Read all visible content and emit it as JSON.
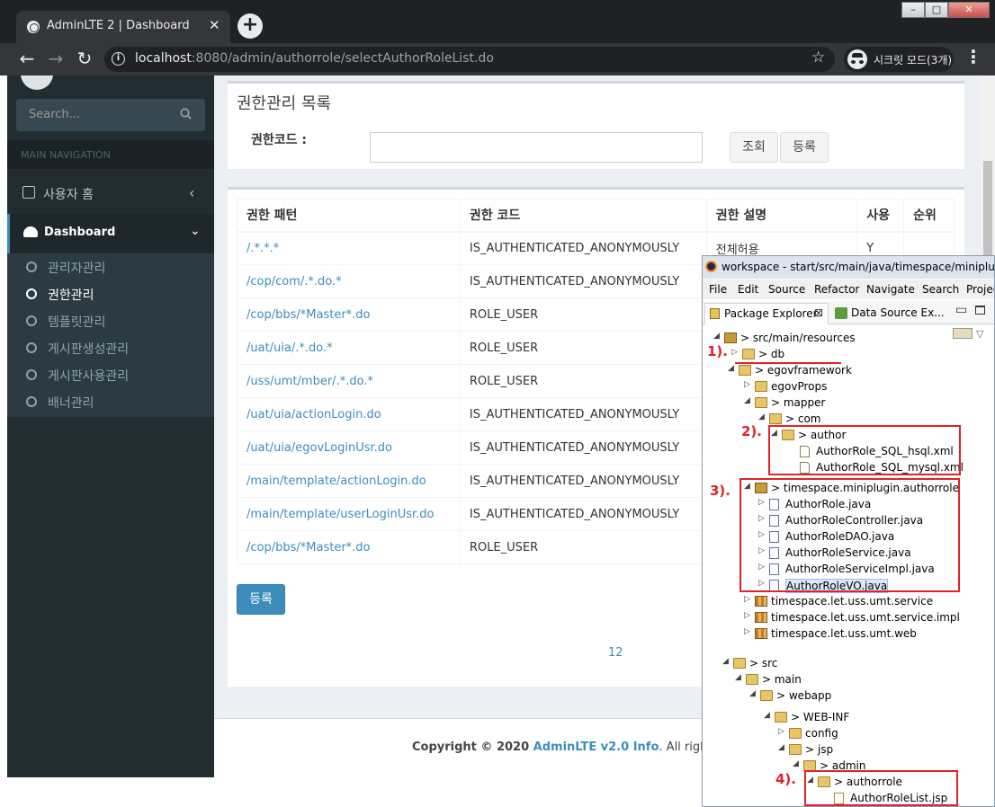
{
  "browser": {
    "tab_title": "AdminLTE 2 | Dashboard",
    "tab_close": "✕",
    "new_tab": "+",
    "url_host": "localhost",
    "url_rest": ":8080/admin/authorrole/selectAuthorRoleList.do",
    "incognito_label": "시크릿 모드(3개)",
    "window_min": "–",
    "window_max": "□",
    "window_close": "✕"
  },
  "sidebar": {
    "search_placeholder": "Search...",
    "header": "MAIN NAVIGATION",
    "home_label": "사용자 홈",
    "dashboard_label": "Dashboard",
    "submenu": [
      {
        "label": "관리자관리"
      },
      {
        "label": "권한관리",
        "active": true
      },
      {
        "label": "템플릿관리"
      },
      {
        "label": "게시판생성관리"
      },
      {
        "label": "게시판사용관리"
      },
      {
        "label": "배너관리"
      }
    ]
  },
  "search_box": {
    "title": "권한관리 목록",
    "field_label": "권한코드 :",
    "field_value": "",
    "query_button": "조회",
    "register_button": "등록"
  },
  "table": {
    "headers": [
      "권한 패턴",
      "권한 코드",
      "권한 설명",
      "사용",
      "순위"
    ],
    "rows": [
      [
        "/.*.*.*",
        "IS_AUTHENTICATED_ANONYMOUSLY",
        "전체허용",
        "Y",
        ""
      ],
      [
        "/cop/com/.*.do.*",
        "IS_AUTHENTICATED_ANONYMOUSLY",
        "",
        "",
        ""
      ],
      [
        "/cop/bbs/*Master*.do",
        "ROLE_USER",
        "",
        "",
        ""
      ],
      [
        "/uat/uia/.*.do.*",
        "ROLE_USER",
        "",
        "",
        ""
      ],
      [
        "/uss/umt/mber/.*.do.*",
        "ROLE_USER",
        "",
        "",
        ""
      ],
      [
        "/uat/uia/actionLogin.do",
        "IS_AUTHENTICATED_ANONYMOUSLY",
        "",
        "",
        ""
      ],
      [
        "/uat/uia/egovLoginUsr.do",
        "IS_AUTHENTICATED_ANONYMOUSLY",
        "",
        "",
        ""
      ],
      [
        "/main/template/actionLogin.do",
        "IS_AUTHENTICATED_ANONYMOUSLY",
        "",
        "",
        ""
      ],
      [
        "/main/template/userLoginUsr.do",
        "IS_AUTHENTICATED_ANONYMOUSLY",
        "",
        "",
        ""
      ],
      [
        "/cop/bbs/*Master*.do",
        "ROLE_USER",
        "",
        "",
        ""
      ]
    ],
    "register_button": "등록",
    "pagination": "12"
  },
  "footer": {
    "prefix": "Copyright © 2020 ",
    "brand": "AdminLTE v2.0 Info",
    "suffix": ". All rights reserv"
  },
  "eclipse": {
    "title": "workspace - start/src/main/java/timespace/miniplugin/au",
    "menu": [
      "File",
      "Edit",
      "Source",
      "Refactor",
      "Navigate",
      "Search",
      "Projec"
    ],
    "tab_package_explorer": "Package Explorer",
    "tab_close": "⊠",
    "tab_datasource": "Data Source Ex...",
    "tree": [
      {
        "label": "> src/main/resources"
      },
      {
        "label": "> db"
      },
      {
        "label": "> egovframework"
      },
      {
        "label": "egovProps"
      },
      {
        "label": "> mapper"
      },
      {
        "label": "> com"
      },
      {
        "label": "> author"
      },
      {
        "label": "AuthorRole_SQL_hsql.xml"
      },
      {
        "label": "AuthorRole_SQL_mysql.xml"
      },
      {
        "label": "> timespace.miniplugin.authorrole"
      },
      {
        "label": "AuthorRole.java"
      },
      {
        "label": "AuthorRoleController.java"
      },
      {
        "label": "AuthorRoleDAO.java"
      },
      {
        "label": "AuthorRoleService.java"
      },
      {
        "label": "AuthorRoleServiceImpl.java"
      },
      {
        "label": "AuthorRoleVO.java"
      },
      {
        "label": "timespace.let.uss.umt.service"
      },
      {
        "label": "timespace.let.uss.umt.service.impl"
      },
      {
        "label": "timespace.let.uss.umt.web"
      },
      {
        "label": "> src"
      },
      {
        "label": "> main"
      },
      {
        "label": "> webapp"
      },
      {
        "label": "> WEB-INF"
      },
      {
        "label": "config"
      },
      {
        "label": "> jsp"
      },
      {
        "label": "> admin"
      },
      {
        "label": "> authorrole"
      },
      {
        "label": "AuthorRoleList.jsp"
      }
    ],
    "annotations": [
      "1).",
      "2).",
      "3).",
      "4)."
    ]
  },
  "colors": {
    "sidebar_bg": "#222d32",
    "accent": "#3c8dbc",
    "annotation_red": "#e0222a"
  }
}
